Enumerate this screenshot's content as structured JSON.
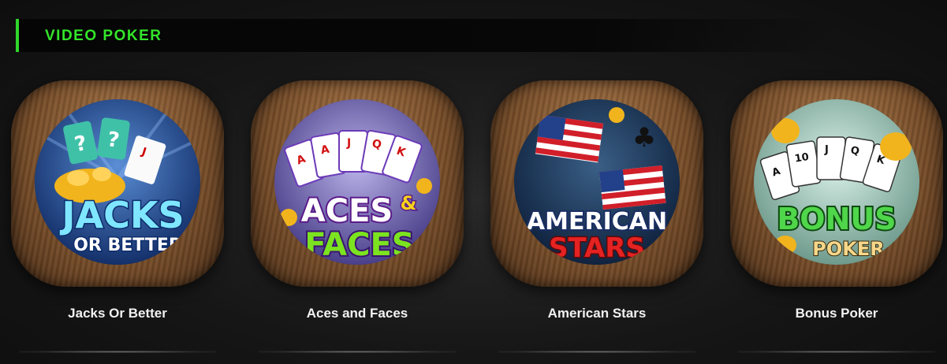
{
  "section": {
    "title": "VIDEO POKER"
  },
  "games": [
    {
      "title": "Jacks Or Better",
      "logo_lines": [
        "JACKS",
        "OR BETTER"
      ]
    },
    {
      "title": "Aces and Faces",
      "logo_lines": [
        "ACES",
        "&",
        "FACES"
      ]
    },
    {
      "title": "American Stars",
      "logo_lines": [
        "AMERICAN",
        "STARS"
      ]
    },
    {
      "title": "Bonus Poker",
      "logo_lines": [
        "BONUS",
        "POKER"
      ]
    }
  ],
  "colors": {
    "accent": "#33e52a",
    "background": "#141414",
    "wood": "#7a4f2a"
  }
}
